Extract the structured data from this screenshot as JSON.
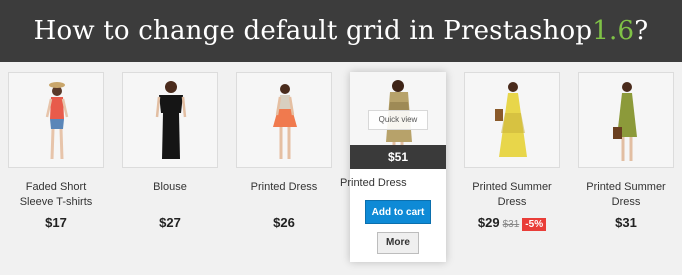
{
  "banner": {
    "title_main": "How to change default grid in Prestashop ",
    "title_version": "1.6",
    "title_end": "?",
    "version_color": "#7fc246"
  },
  "products": [
    {
      "name_line1": "Faded Short",
      "name_line2": "Sleeve T-shirts",
      "price": "$17"
    },
    {
      "name_line1": "Blouse",
      "name_line2": "",
      "price": "$27"
    },
    {
      "name_line1": "Printed Dress",
      "name_line2": "",
      "price": "$26"
    },
    {
      "name_line1": "Printed Dress",
      "name_line2": "",
      "price": "$51",
      "quick_view": "Quick view",
      "add_to_cart": "Add to cart",
      "more": "More"
    },
    {
      "name_line1": "Printed Summer",
      "name_line2": "Dress",
      "price": "$29",
      "old_price": "$31",
      "discount": "-5%"
    },
    {
      "name_line1": "Printed Summer",
      "name_line2": "Dress",
      "price": "$31"
    }
  ]
}
